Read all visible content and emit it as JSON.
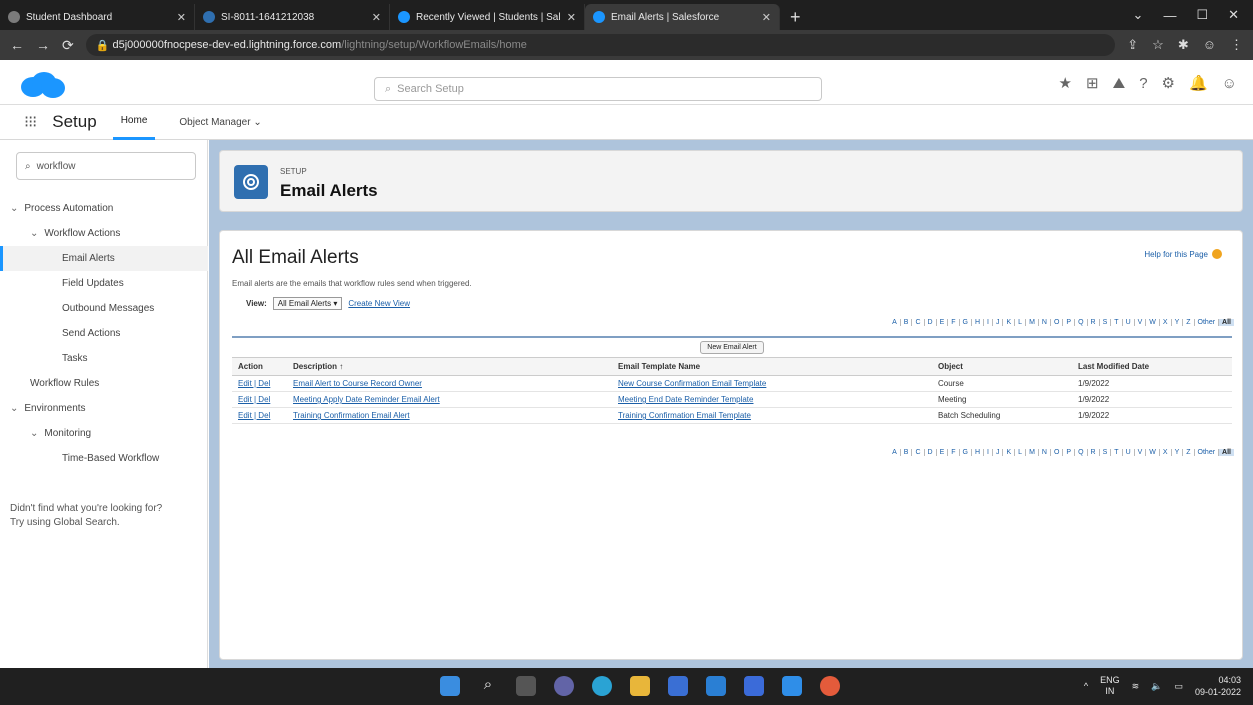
{
  "browser": {
    "tabs": [
      {
        "title": "Student Dashboard",
        "color": "#7b7b7b",
        "active": false
      },
      {
        "title": "SI-8011-1641212038",
        "color": "#2f6fb0",
        "active": false
      },
      {
        "title": "Recently Viewed | Students | Sal",
        "color": "#1b96ff",
        "active": false
      },
      {
        "title": "Email Alerts | Salesforce",
        "color": "#1b96ff",
        "active": true
      }
    ],
    "url_host": "d5j000000fnocpese-dev-ed.lightning.force.com",
    "url_path": "/lightning/setup/WorkflowEmails/home"
  },
  "header": {
    "search_placeholder": "Search Setup"
  },
  "nav": {
    "app_title": "Setup",
    "tabs": [
      "Home",
      "Object Manager"
    ]
  },
  "sidebar": {
    "search_value": "workflow",
    "items": [
      {
        "label": "Process Automation",
        "level": 0,
        "expanded": true
      },
      {
        "label": "Workflow Actions",
        "level": 1,
        "expanded": true
      },
      {
        "label": "Email Alerts",
        "level": 2,
        "selected": true
      },
      {
        "label": "Field Updates",
        "level": 2
      },
      {
        "label": "Outbound Messages",
        "level": 2
      },
      {
        "label": "Send Actions",
        "level": 2
      },
      {
        "label": "Tasks",
        "level": 2
      },
      {
        "label": "Workflow Rules",
        "level": 1
      },
      {
        "label": "Environments",
        "level": 0,
        "expanded": true
      },
      {
        "label": "Monitoring",
        "level": 1,
        "expanded": true
      },
      {
        "label": "Time-Based Workflow",
        "level": 2
      }
    ],
    "help_line1": "Didn't find what you're looking for?",
    "help_line2": "Try using Global Search."
  },
  "page": {
    "crumb": "SETUP",
    "title": "Email Alerts"
  },
  "content": {
    "heading": "All Email Alerts",
    "help_link": "Help for this Page",
    "description": "Email alerts are the emails that workflow rules send when triggered.",
    "view_label": "View:",
    "view_value": "All Email Alerts",
    "create_view": "Create New View",
    "alphabet": [
      "A",
      "B",
      "C",
      "D",
      "E",
      "F",
      "G",
      "H",
      "I",
      "J",
      "K",
      "L",
      "M",
      "N",
      "O",
      "P",
      "Q",
      "R",
      "S",
      "T",
      "U",
      "V",
      "W",
      "X",
      "Y",
      "Z",
      "Other",
      "All"
    ],
    "new_button": "New Email Alert",
    "columns": [
      "Action",
      "Description ↑",
      "Email Template Name",
      "Object",
      "Last Modified Date"
    ],
    "rows": [
      {
        "action": "Edit | Del",
        "description": "Email Alert to Course Record Owner",
        "template": "New Course Confirmation Email Template",
        "object": "Course",
        "date": "1/9/2022"
      },
      {
        "action": "Edit | Del",
        "description": "Meeting Apply Date Reminder Email Alert",
        "template": "Meeting End Date Reminder Template",
        "object": "Meeting",
        "date": "1/9/2022"
      },
      {
        "action": "Edit | Del",
        "description": "Training Confirmation Email Alert",
        "template": "Training Confirmation Email Template",
        "object": "Batch Scheduling",
        "date": "1/9/2022"
      }
    ]
  },
  "taskbar": {
    "lang": "ENG",
    "region": "IN",
    "time": "04:03",
    "date": "09-01-2022"
  }
}
